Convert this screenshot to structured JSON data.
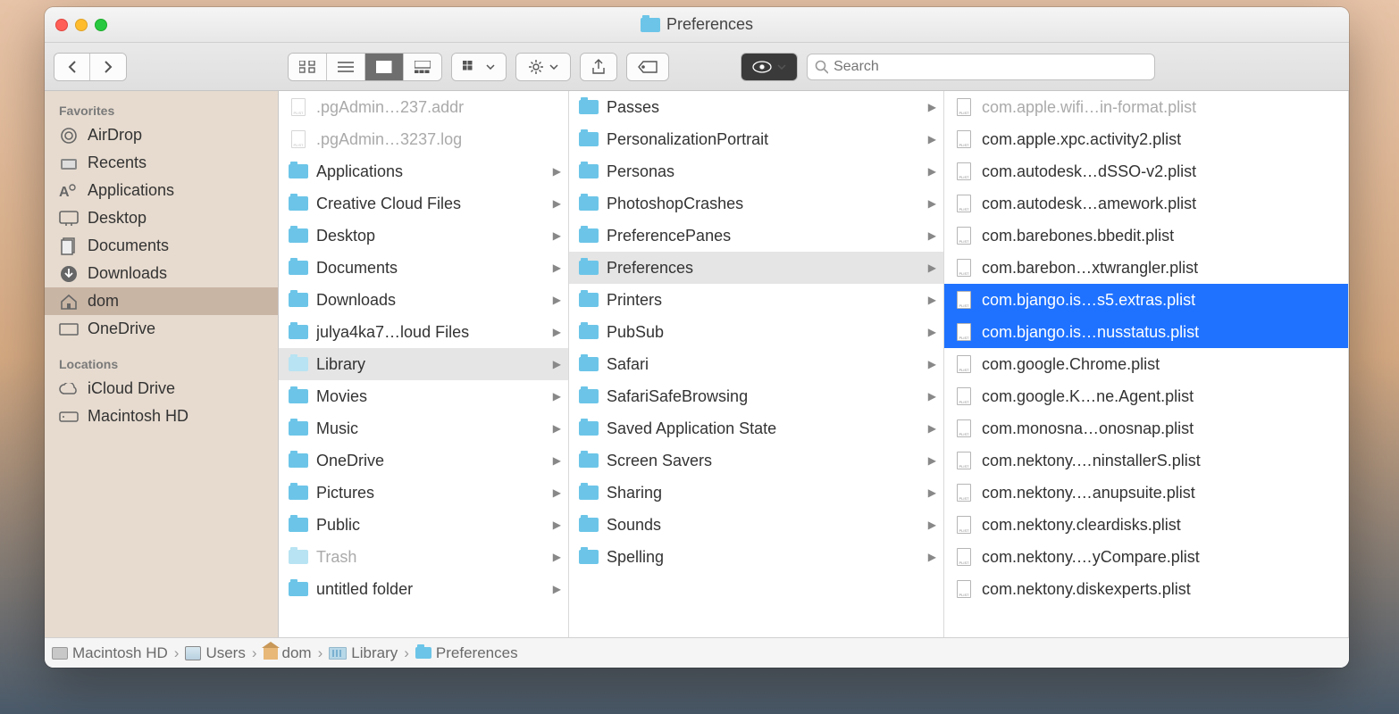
{
  "window_title": "Preferences",
  "search_placeholder": "Search",
  "sidebar": {
    "favorites_header": "Favorites",
    "locations_header": "Locations",
    "favorites": [
      {
        "name": "airdrop",
        "label": "AirDrop"
      },
      {
        "name": "recents",
        "label": "Recents"
      },
      {
        "name": "applications",
        "label": "Applications"
      },
      {
        "name": "desktop",
        "label": "Desktop"
      },
      {
        "name": "documents",
        "label": "Documents"
      },
      {
        "name": "downloads",
        "label": "Downloads"
      },
      {
        "name": "dom",
        "label": "dom",
        "selected": true
      },
      {
        "name": "onedrive",
        "label": "OneDrive"
      }
    ],
    "locations": [
      {
        "name": "icloud",
        "label": "iCloud Drive"
      },
      {
        "name": "macintosh-hd",
        "label": "Macintosh HD"
      }
    ]
  },
  "col1": [
    {
      "label": ".pgAdmin…237.addr",
      "type": "file",
      "dim": true
    },
    {
      "label": ".pgAdmin…3237.log",
      "type": "file",
      "dim": true
    },
    {
      "label": "Applications",
      "type": "folder"
    },
    {
      "label": "Creative Cloud Files",
      "type": "folder"
    },
    {
      "label": "Desktop",
      "type": "folder"
    },
    {
      "label": "Documents",
      "type": "folder"
    },
    {
      "label": "Downloads",
      "type": "folder"
    },
    {
      "label": "julya4ka7…loud Files",
      "type": "folder"
    },
    {
      "label": "Library",
      "type": "folder",
      "selected": true,
      "dimfolder": true
    },
    {
      "label": "Movies",
      "type": "folder"
    },
    {
      "label": "Music",
      "type": "folder"
    },
    {
      "label": "OneDrive",
      "type": "folder"
    },
    {
      "label": "Pictures",
      "type": "folder"
    },
    {
      "label": "Public",
      "type": "folder"
    },
    {
      "label": "Trash",
      "type": "folder",
      "dimfolder": true,
      "dim": true
    },
    {
      "label": "untitled folder",
      "type": "folder"
    }
  ],
  "col2": [
    {
      "label": "Passes",
      "type": "folder"
    },
    {
      "label": "PersonalizationPortrait",
      "type": "folder"
    },
    {
      "label": "Personas",
      "type": "folder"
    },
    {
      "label": "PhotoshopCrashes",
      "type": "folder"
    },
    {
      "label": "PreferencePanes",
      "type": "folder"
    },
    {
      "label": "Preferences",
      "type": "folder",
      "selected": true
    },
    {
      "label": "Printers",
      "type": "folder"
    },
    {
      "label": "PubSub",
      "type": "folder"
    },
    {
      "label": "Safari",
      "type": "folder"
    },
    {
      "label": "SafariSafeBrowsing",
      "type": "folder"
    },
    {
      "label": "Saved Application State",
      "type": "folder"
    },
    {
      "label": "Screen Savers",
      "type": "folder"
    },
    {
      "label": "Sharing",
      "type": "folder"
    },
    {
      "label": "Sounds",
      "type": "folder"
    },
    {
      "label": "Spelling",
      "type": "folder"
    }
  ],
  "col3": [
    {
      "label": "com.apple.wifi…in-format.plist",
      "type": "plist",
      "dim": true
    },
    {
      "label": "com.apple.xpc.activity2.plist",
      "type": "plist"
    },
    {
      "label": "com.autodesk…dSSO-v2.plist",
      "type": "plist"
    },
    {
      "label": "com.autodesk…amework.plist",
      "type": "plist"
    },
    {
      "label": "com.barebones.bbedit.plist",
      "type": "plist"
    },
    {
      "label": "com.barebon…xtwrangler.plist",
      "type": "plist"
    },
    {
      "label": "com.bjango.is…s5.extras.plist",
      "type": "plist",
      "selblue": true
    },
    {
      "label": "com.bjango.is…nusstatus.plist",
      "type": "plist",
      "selblue": true
    },
    {
      "label": "com.google.Chrome.plist",
      "type": "plist"
    },
    {
      "label": "com.google.K…ne.Agent.plist",
      "type": "plist"
    },
    {
      "label": "com.monosna…onosnap.plist",
      "type": "plist"
    },
    {
      "label": "com.nektony.…ninstallerS.plist",
      "type": "plist"
    },
    {
      "label": "com.nektony.…anupsuite.plist",
      "type": "plist"
    },
    {
      "label": "com.nektony.cleardisks.plist",
      "type": "plist"
    },
    {
      "label": "com.nektony.…yCompare.plist",
      "type": "plist"
    },
    {
      "label": "com.nektony.diskexperts.plist",
      "type": "plist"
    }
  ],
  "path": [
    {
      "label": "Macintosh HD",
      "icon": "hdd"
    },
    {
      "label": "Users",
      "icon": "users"
    },
    {
      "label": "dom",
      "icon": "home"
    },
    {
      "label": "Library",
      "icon": "lib"
    },
    {
      "label": "Preferences",
      "icon": "folder"
    }
  ]
}
